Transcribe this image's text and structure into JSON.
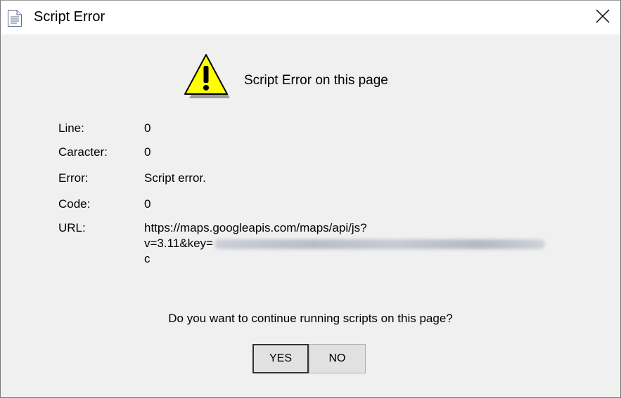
{
  "window": {
    "title": "Script Error",
    "icon": "document-icon",
    "close_icon": "close-icon"
  },
  "dialog": {
    "icon": "warning-icon",
    "heading": "Script Error on this page",
    "details": [
      {
        "label": "Line:",
        "value": "0"
      },
      {
        "label": "Caracter:",
        "value": "0"
      },
      {
        "label": "Error:",
        "value": "Script error."
      },
      {
        "label": "Code:",
        "value": "0"
      }
    ],
    "url_label": "URL:",
    "url_line1": "https://maps.googleapis.com/maps/api/js?",
    "url_line2": "v=3.11&key=",
    "url_line3": "c",
    "question": "Do you want to continue running scripts on this page?",
    "yes_label": "YES",
    "no_label": "NO"
  },
  "colors": {
    "titlebar": "#ffffff",
    "body": "#f0f0f0",
    "warning_fill": "#ffff00"
  }
}
